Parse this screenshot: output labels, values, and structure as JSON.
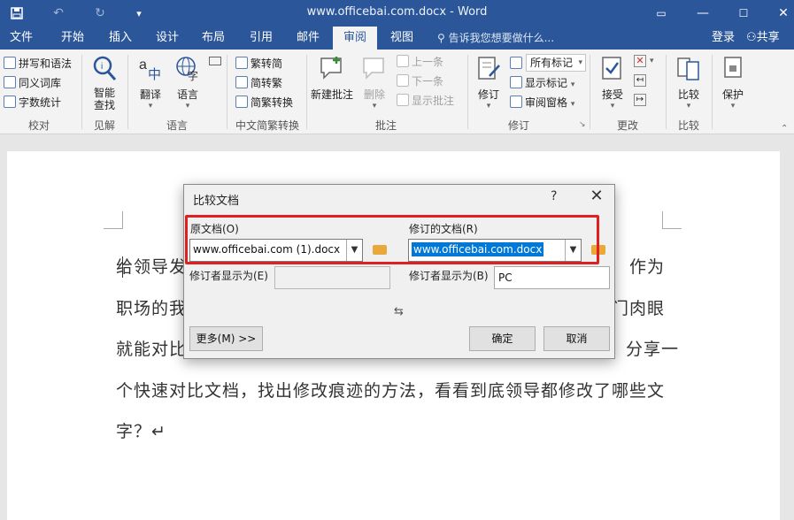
{
  "window": {
    "title": "www.officebai.com.docx - Word",
    "qa": {
      "save_icon": "save-icon",
      "undo_icon": "undo-icon",
      "redo_icon": "redo-icon",
      "customize_icon": "customize-qat-icon"
    },
    "controls": {
      "ribbon_options_icon": "ribbon-display-icon",
      "minimize_icon": "minimize-icon",
      "maximize_icon": "maximize-icon",
      "close_icon": "close-icon"
    }
  },
  "tabs": [
    "文件",
    "开始",
    "插入",
    "设计",
    "布局",
    "引用",
    "邮件",
    "审阅",
    "视图"
  ],
  "active_tab": "审阅",
  "tell_me": "告诉我您想要做什么...",
  "login": "登录",
  "share": "共享",
  "ribbon": {
    "proofing": {
      "label": "校对",
      "items": [
        "拼写和语法",
        "同义词库",
        "字数统计"
      ]
    },
    "insights": {
      "label": "见解",
      "smart_lookup": "智能\n查找"
    },
    "language": {
      "label": "语言",
      "translate": "翻译",
      "language": "语言"
    },
    "chinese_conversion": {
      "label": "中文简繁转换",
      "items": [
        "繁转简",
        "简转繁",
        "简繁转换"
      ]
    },
    "comments": {
      "label": "批注",
      "new_comment": "新建批注",
      "delete": "删除",
      "previous": "上一条",
      "next": "下一条",
      "show_comments": "显示批注"
    },
    "tracking": {
      "label": "修订",
      "track_changes": "修订",
      "markup_dropdown": "所有标记",
      "show_markup": "显示标记",
      "reviewing_pane": "审阅窗格"
    },
    "changes": {
      "label": "更改",
      "accept": "接受"
    },
    "compare": {
      "label": "比较",
      "compare": "比较"
    },
    "protect": {
      "label": "",
      "protect": "保护"
    }
  },
  "document": {
    "lines": [
      "给领导发",
      "作为",
      "职场的我",
      "门肉眼",
      "就能对比",
      "分享一",
      "个快速对比文档，找出修改痕迹的方法，看看到底领导都修改了哪些文",
      "字？↵"
    ]
  },
  "dialog": {
    "title": "比较文档",
    "help": "?",
    "close": "✕",
    "original_label": "原文档(O)",
    "original_value": "www.officebai.com (1).docx",
    "revised_label": "修订的文档(R)",
    "revised_value": "www.officebai.com.docx",
    "label_changes_left": "修订者显示为(E)",
    "label_changes_left_value": "",
    "label_changes_right": "修订者显示为(B)",
    "label_changes_right_value": "PC",
    "swap_icon": "swap-icon",
    "more_button": "更多(M) >>",
    "ok_button": "确定",
    "cancel_button": "取消"
  },
  "colors": {
    "word_blue": "#2b579a",
    "highlight_red": "#e02020",
    "selection_blue": "#0078d7"
  }
}
